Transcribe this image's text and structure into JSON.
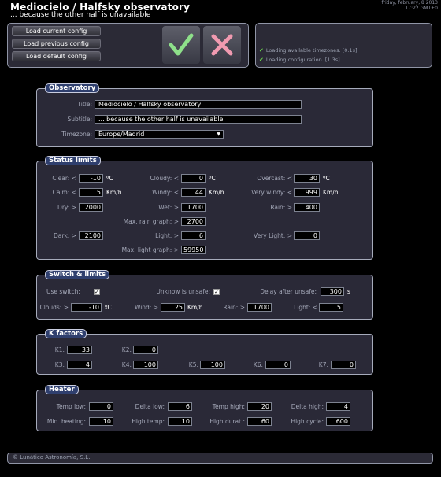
{
  "header": {
    "title": "Mediocielo / Halfsky observatory",
    "subtitle": "... because the other half is unavailable",
    "clock_line1": "friday, february, 8 2013",
    "clock_line2": "17:22 GMT+0"
  },
  "config": {
    "load_current": "Load current config",
    "load_previous": "Load previous config",
    "load_default": "Load default config"
  },
  "log": [
    "Loading available timezones. [0.1s]",
    "Loading configuration. [1.3s]"
  ],
  "colors": {
    "accent": "#2f3f6e",
    "ok": "#8ee08a",
    "cancel": "#f09ab0",
    "check": "#6ad14e"
  },
  "observatory": {
    "legend": "Observatory",
    "title_label": "Title:",
    "title_value": "Mediocielo / Halfsky observatory",
    "subtitle_label": "Subtitle:",
    "subtitle_value": "... because the other half is unavailable",
    "timezone_label": "Timezone:",
    "timezone_value": "Europe/Madrid"
  },
  "status": {
    "legend": "Status limits",
    "clear_label": "Clear: <",
    "clear_value": "-10",
    "clear_unit": "ºC",
    "cloudy_label": "Cloudy: <",
    "cloudy_value": "0",
    "cloudy_unit": "ºC",
    "overcast_label": "Overcast: <",
    "overcast_value": "30",
    "overcast_unit": "ºC",
    "calm_label": "Calm: <",
    "calm_value": "5",
    "calm_unit": "Km/h",
    "windy_label": "Windy: <",
    "windy_value": "44",
    "windy_unit": "Km/h",
    "verywindy_label": "Very windy: <",
    "verywindy_value": "999",
    "verywindy_unit": "Km/h",
    "dry_label": "Dry: >",
    "dry_value": "2000",
    "wet_label": "Wet: >",
    "wet_value": "1700",
    "rain_label": "Rain: >",
    "rain_value": "400",
    "maxrain_label": "Max. rain graph: >",
    "maxrain_value": "2700",
    "dark_label": "Dark: >",
    "dark_value": "2100",
    "light_label": "Light: >",
    "light_value": "6",
    "verylight_label": "Very Light: >",
    "verylight_value": "0",
    "maxlight_label": "Max. light graph: >",
    "maxlight_value": "59950"
  },
  "switch": {
    "legend": "Switch & limits",
    "use_switch_label": "Use switch:",
    "use_switch_checked": "✓",
    "unknow_label": "Unknow is unsafe:",
    "unknow_checked": "✓",
    "delay_label": "Delay after unsafe:",
    "delay_value": "300",
    "delay_unit": "s",
    "clouds_label": "Clouds: >",
    "clouds_value": "-10",
    "clouds_unit": "ºC",
    "wind_label": "Wind: >",
    "wind_value": "25",
    "wind_unit": "Km/h",
    "rain_label": "Rain: >",
    "rain_value": "1700",
    "light_label": "Light: <",
    "light_value": "15"
  },
  "kfactors": {
    "legend": "K factors",
    "k1_label": "K1:",
    "k1_value": "33",
    "k2_label": "K2:",
    "k2_value": "0",
    "k3_label": "K3:",
    "k3_value": "4",
    "k4_label": "K4:",
    "k4_value": "100",
    "k5_label": "K5:",
    "k5_value": "100",
    "k6_label": "K6:",
    "k6_value": "0",
    "k7_label": "K7:",
    "k7_value": "0"
  },
  "heater": {
    "legend": "Heater",
    "templow_label": "Temp low:",
    "templow_value": "0",
    "deltalow_label": "Delta low:",
    "deltalow_value": "6",
    "temphigh_label": "Temp high:",
    "temphigh_value": "20",
    "deltahigh_label": "Delta high:",
    "deltahigh_value": "4",
    "minheating_label": "Min. heating:",
    "minheating_value": "10",
    "hightemp_label": "High temp:",
    "hightemp_value": "10",
    "highdurat_label": "High durat.:",
    "highdurat_value": "60",
    "highcycle_label": "High cycle:",
    "highcycle_value": "600"
  },
  "footer": {
    "text": "© Lunático Astronomía, S.L."
  }
}
